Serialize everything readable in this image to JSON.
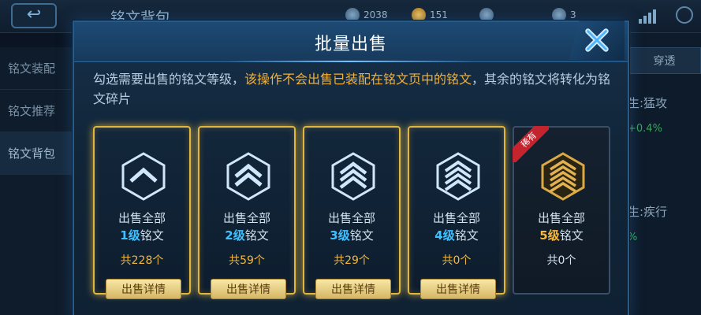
{
  "background": {
    "back_icon": "back-arrow-icon",
    "title": "铭文背包",
    "resources": [
      {
        "icon": "gem-icon",
        "value": "2038"
      },
      {
        "icon": "coin-icon",
        "value": "151"
      },
      {
        "icon": "fragment-icon",
        "value": ""
      },
      {
        "icon": "scroll-icon",
        "value": "3"
      }
    ],
    "sidebar": [
      "铭文装配",
      "铭文推荐",
      "铭文背包"
    ],
    "right_tab": "穿透",
    "right_stats": [
      {
        "label": "生:猛攻",
        "pct": "+0.4%"
      },
      {
        "label": "生:疾行",
        "pct": "%"
      }
    ]
  },
  "modal": {
    "title": "批量出售",
    "description_prefix": "勾选需要出售的铭文等级，",
    "description_highlight": "该操作不会出售已装配在铭文页中的铭文",
    "description_suffix": "，其余的铭文将转化为铭文碎片",
    "close_icon": "close-x-icon",
    "cards": [
      {
        "line1": "出售全部",
        "level": "1级",
        "suffix": "铭文",
        "count": "共228个",
        "button": "出售详情",
        "selected": true
      },
      {
        "line1": "出售全部",
        "level": "2级",
        "suffix": "铭文",
        "count": "共59个",
        "button": "出售详情",
        "selected": true
      },
      {
        "line1": "出售全部",
        "level": "3级",
        "suffix": "铭文",
        "count": "共29个",
        "button": "出售详情",
        "selected": true
      },
      {
        "line1": "出售全部",
        "level": "4级",
        "suffix": "铭文",
        "count": "共0个",
        "button": "出售详情",
        "selected": true
      },
      {
        "line1": "出售全部",
        "level": "5级",
        "suffix": "铭文",
        "count": "共0个",
        "badge": "稀有",
        "selected": false
      }
    ]
  },
  "colors": {
    "accent_gold": "#f2b035",
    "level_blue": "#3fc0ff",
    "level_gold": "#f6b93b",
    "rare_red": "#c4242e"
  }
}
